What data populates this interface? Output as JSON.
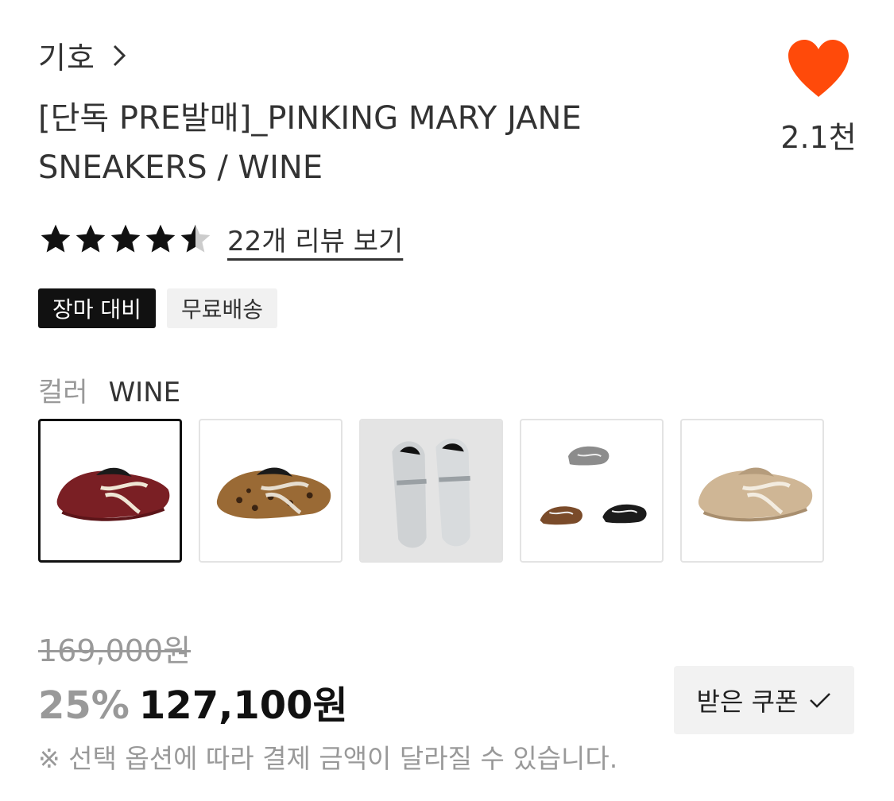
{
  "brand": {
    "name": "기호",
    "chevron_icon": "chevron-right-icon"
  },
  "like": {
    "icon": "heart-icon",
    "color": "#ff4a0a",
    "count": "2.1천"
  },
  "product": {
    "title_line1": "[단독 PRE발매]_PINKING MARY JANE",
    "title_line2": "SNEAKERS / WINE"
  },
  "rating": {
    "value": 4.5,
    "max": 5,
    "reviews_label": "22개 리뷰 보기"
  },
  "badges": [
    {
      "label": "장마 대비",
      "style": "dark"
    },
    {
      "label": "무료배송",
      "style": "light"
    }
  ],
  "color": {
    "label": "컬러",
    "selected": "WINE",
    "options": [
      {
        "name": "wine",
        "color": "#7a1f24",
        "selected": true
      },
      {
        "name": "leopard",
        "color": "#8a5a2b",
        "selected": false
      },
      {
        "name": "silver",
        "color": "#c9c9c9",
        "selected": false
      },
      {
        "name": "multi",
        "color": "#6b6b6b",
        "selected": false
      },
      {
        "name": "beige",
        "color": "#cdb596",
        "selected": false
      }
    ]
  },
  "price": {
    "original": "169,000원",
    "discount": "25%",
    "final": "127,100원"
  },
  "coupon": {
    "label": "받은 쿠폰",
    "icon": "check-icon"
  },
  "notice": "※ 선택 옵션에 따라 결제 금액이 달라질 수 있습니다."
}
